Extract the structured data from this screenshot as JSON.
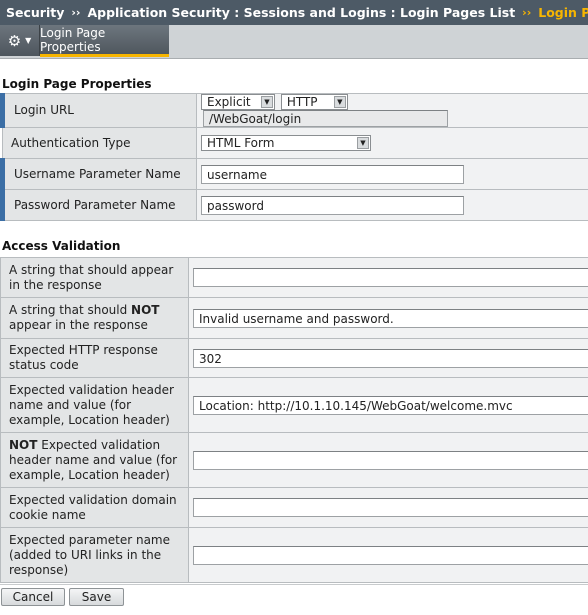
{
  "breadcrumb": {
    "items": [
      "Security",
      "Application Security : Sessions and Logins : Login Pages List"
    ],
    "separator": "››",
    "active": "Login Page Properties"
  },
  "toolbar": {
    "gear_icon": "⚙",
    "caret_icon": "▼",
    "tab_label": "Login Page Properties"
  },
  "login_section": {
    "title": "Login Page Properties",
    "rows": {
      "login_url": {
        "label": "Login URL",
        "match_type": "Explicit",
        "protocol": "HTTP",
        "url": "/WebGoat/login"
      },
      "auth_type": {
        "label": "Authentication Type",
        "value": "HTML Form"
      },
      "username_param": {
        "label": "Username Parameter Name",
        "value": "username"
      },
      "password_param": {
        "label": "Password Parameter Name",
        "value": "password"
      }
    }
  },
  "access_section": {
    "title": "Access Validation",
    "rows": [
      {
        "label_pre": "",
        "label_bold": "",
        "label_post": "A string that should appear in the response",
        "value": ""
      },
      {
        "label_pre": "A string that should ",
        "label_bold": "NOT",
        "label_post": " appear in the response",
        "value": "Invalid username and password."
      },
      {
        "label_pre": "",
        "label_bold": "",
        "label_post": "Expected HTTP response status code",
        "value": "302"
      },
      {
        "label_pre": "",
        "label_bold": "",
        "label_post": "Expected validation header name and value (for example, Location header)",
        "value": "Location: http://10.1.10.145/WebGoat/welcome.mvc"
      },
      {
        "label_pre": "",
        "label_bold": "NOT",
        "label_post": " Expected validation header name and value (for example, Location header)",
        "value": ""
      },
      {
        "label_pre": "",
        "label_bold": "",
        "label_post": "Expected validation domain cookie name",
        "value": ""
      },
      {
        "label_pre": "",
        "label_bold": "",
        "label_post": "Expected parameter name (added to URI links in the response)",
        "value": ""
      }
    ]
  },
  "buttons": {
    "cancel": "Cancel",
    "save": "Save"
  },
  "colors": {
    "header_bg": "#4d5a66",
    "accent": "#f7b500",
    "required_marker": "#3b6ea5"
  }
}
